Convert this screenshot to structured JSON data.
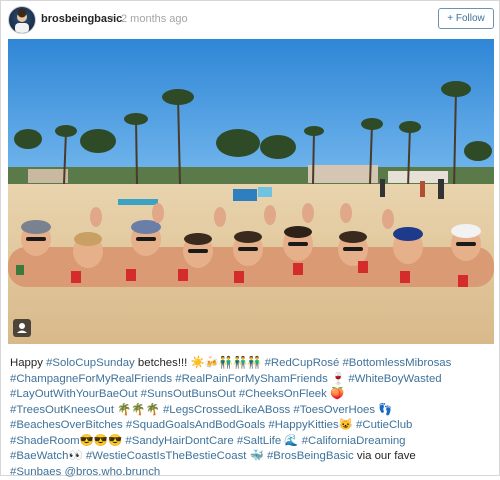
{
  "post": {
    "username": "brosbeingbasic",
    "separator": "•",
    "timestamp": "2 months ago",
    "follow_label": "+ Follow"
  },
  "photo": {
    "description_icon": "photo-tag-icon"
  },
  "caption": {
    "lines": [
      [
        {
          "t": "Happy ",
          "tag": false
        },
        {
          "t": "#SoloCupSunday",
          "tag": true
        },
        {
          "t": " betches!!! ☀️🍻👬👬👬 ",
          "tag": false
        },
        {
          "t": "#RedCupRosé",
          "tag": true
        },
        {
          "t": " ",
          "tag": false
        },
        {
          "t": "#BottomlessMibrosas",
          "tag": true
        }
      ],
      [
        {
          "t": "#ChampagneForMyRealFriends",
          "tag": true
        },
        {
          "t": " ",
          "tag": false
        },
        {
          "t": "#RealPainForMyShamFriends",
          "tag": true
        },
        {
          "t": " 🍷 ",
          "tag": false
        },
        {
          "t": "#WhiteBoyWasted",
          "tag": true
        }
      ],
      [
        {
          "t": "#LayOutWithYourBaeOut",
          "tag": true
        },
        {
          "t": " ",
          "tag": false
        },
        {
          "t": "#SunsOutBunsOut",
          "tag": true
        },
        {
          "t": " ",
          "tag": false
        },
        {
          "t": "#CheeksOnFleek",
          "tag": true
        },
        {
          "t": " 🍑",
          "tag": false
        }
      ],
      [
        {
          "t": "#TreesOutKneesOut",
          "tag": true
        },
        {
          "t": " 🌴🌴🌴 ",
          "tag": false
        },
        {
          "t": "#LegsCrossedLikeABoss",
          "tag": true
        },
        {
          "t": " ",
          "tag": false
        },
        {
          "t": "#ToesOverHoes",
          "tag": true
        },
        {
          "t": " 👣",
          "tag": false
        }
      ],
      [
        {
          "t": "#BeachesOverBitches",
          "tag": true
        },
        {
          "t": " ",
          "tag": false
        },
        {
          "t": "#SquadGoalsAndBodGoals",
          "tag": true
        },
        {
          "t": " ",
          "tag": false
        },
        {
          "t": "#HappyKitties",
          "tag": true
        },
        {
          "t": "😺 ",
          "tag": false
        },
        {
          "t": "#CutieClub",
          "tag": true
        }
      ],
      [
        {
          "t": "#ShadeRoom",
          "tag": true
        },
        {
          "t": "😎😎😎 ",
          "tag": false
        },
        {
          "t": "#SandyHairDontCare",
          "tag": true
        },
        {
          "t": " ",
          "tag": false
        },
        {
          "t": "#SaltLife",
          "tag": true
        },
        {
          "t": " 🌊 ",
          "tag": false
        },
        {
          "t": "#CaliforniaDreaming",
          "tag": true
        }
      ],
      [
        {
          "t": "#BaeWatch",
          "tag": true
        },
        {
          "t": "👀 ",
          "tag": false
        },
        {
          "t": "#WestieCoastIsTheBestieCoast",
          "tag": true
        },
        {
          "t": " 🐳 ",
          "tag": false
        },
        {
          "t": "#BrosBeingBasic",
          "tag": true
        },
        {
          "t": " via our fave",
          "tag": false
        }
      ],
      [
        {
          "t": "#Sunbaes",
          "tag": true
        },
        {
          "t": " ",
          "tag": false
        },
        {
          "t": "@bros.who.brunch",
          "tag": true
        }
      ]
    ]
  },
  "colors": {
    "link": "#3f729b",
    "text": "#262626",
    "sky": "#3e95dc",
    "sand": "#e4c9a0"
  }
}
